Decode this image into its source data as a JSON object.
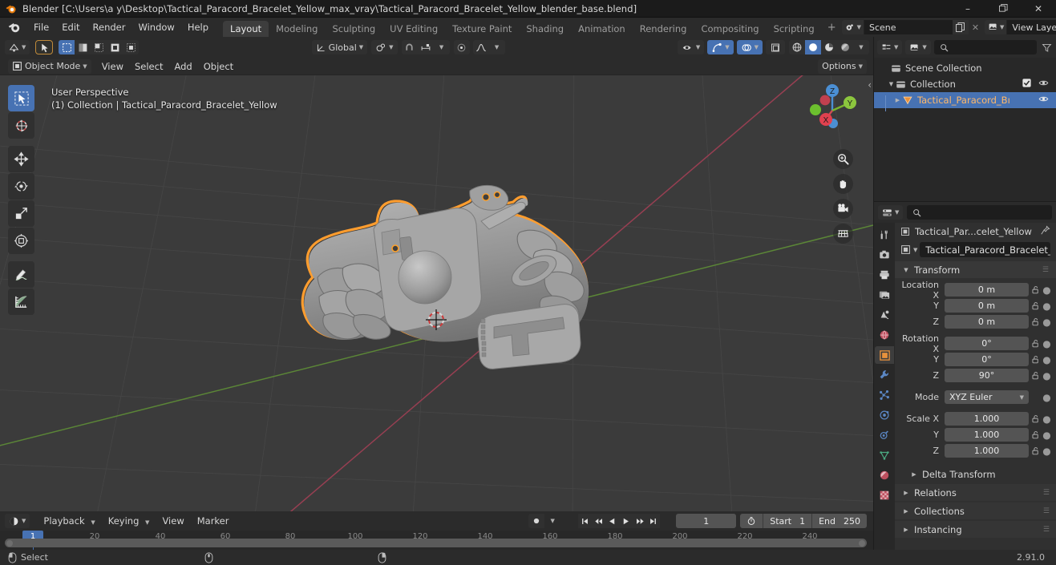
{
  "window": {
    "title": "Blender [C:\\Users\\a y\\Desktop\\Tactical_Paracord_Bracelet_Yellow_max_vray\\Tactical_Paracord_Bracelet_Yellow_blender_base.blend]",
    "minimize": "–",
    "maximize": "❐",
    "close": "✕"
  },
  "menubar": {
    "items": [
      "File",
      "Edit",
      "Render",
      "Window",
      "Help"
    ]
  },
  "workspace_tabs": {
    "items": [
      "Layout",
      "Modeling",
      "Sculpting",
      "UV Editing",
      "Texture Paint",
      "Shading",
      "Animation",
      "Rendering",
      "Compositing",
      "Scripting"
    ],
    "active": "Layout",
    "add_label": "+"
  },
  "topbar_right": {
    "scene_name": "Scene",
    "view_layer_name": "View Layer",
    "scene_icon": "scene-icon",
    "view_layer_icon": "view-layer-icon",
    "copy_icon": "new-copy-icon",
    "close_icon": "✕"
  },
  "viewport": {
    "mode_label": "Object Mode",
    "menus": [
      "View",
      "Select",
      "Add",
      "Object"
    ],
    "transform_orientation": "Global",
    "options_label": "Options",
    "overlay_line1": "User Perspective",
    "overlay_line2": "(1) Collection | Tactical_Paracord_Bracelet_Yellow",
    "gizmo_axes": [
      "X",
      "Y",
      "Z"
    ],
    "tools": [
      "tweak-select-tool",
      "cursor-tool",
      "move-tool",
      "rotate-tool",
      "scale-tool",
      "transform-tool",
      "annotate-tool",
      "measure-tool"
    ],
    "nav_buttons": [
      "zoom-icon",
      "pan-hand-icon",
      "camera-view-icon",
      "toggle-ortho-icon"
    ],
    "header_icons": [
      "editor-type-icon",
      "select-mode-icon",
      "box-select-icon",
      "circle-select-icon",
      "lasso-select-icon",
      "snap-magnet-icon",
      "proportional-edit-icon",
      "visibility-icon",
      "gizmo-icon",
      "overlays-icon",
      "xray-icon",
      "shading-wireframe",
      "shading-solid",
      "shading-material",
      "shading-rendered"
    ]
  },
  "outliner": {
    "filter_icon": "filter-icon",
    "display_mode_icon": "display-mode-icon",
    "search_placeholder": "",
    "rows": [
      {
        "label": "Scene Collection",
        "icon": "collection-icon",
        "indent": 10,
        "expand": "",
        "selected": false,
        "checkbox": false,
        "eye": false
      },
      {
        "label": "Collection",
        "icon": "collection-icon",
        "indent": 16,
        "expand": "▼",
        "selected": false,
        "checkbox": true,
        "eye": true
      },
      {
        "label": "Tactical_Paracord_Bı",
        "icon": "mesh-object-icon",
        "indent": 31,
        "expand": "▶",
        "selected": true,
        "checkbox": false,
        "eye": true
      }
    ]
  },
  "properties": {
    "editor_icon": "properties-editor-icon",
    "search_placeholder": "",
    "tabs": [
      "tool-tab",
      "render-tab",
      "output-tab",
      "view-layer-tab",
      "scene-tab",
      "world-tab",
      "object-tab",
      "modifier-tab",
      "particles-tab",
      "physics-tab",
      "constraints-tab",
      "object-data-tab",
      "material-tab",
      "texture-tab"
    ],
    "active_tab": "object-tab",
    "breadcrumb": "Tactical_Par...celet_Yellow",
    "pin_icon": "pin-icon",
    "object_name": "Tactical_Paracord_Bracelet_...",
    "transform_panel": {
      "title": "Transform",
      "rows": [
        {
          "label": "Location X",
          "value": "0 m",
          "lock": true,
          "anim": true
        },
        {
          "label": "Y",
          "value": "0 m",
          "lock": true,
          "anim": true
        },
        {
          "label": "Z",
          "value": "0 m",
          "lock": true,
          "anim": true
        }
      ],
      "rotation_rows": [
        {
          "label": "Rotation X",
          "value": "0°",
          "lock": true,
          "anim": true
        },
        {
          "label": "Y",
          "value": "0°",
          "lock": true,
          "anim": true
        },
        {
          "label": "Z",
          "value": "90°",
          "lock": true,
          "anim": true
        }
      ],
      "mode_label": "Mode",
      "mode_value": "XYZ Euler",
      "scale_rows": [
        {
          "label": "Scale X",
          "value": "1.000",
          "lock": true,
          "anim": true
        },
        {
          "label": "Y",
          "value": "1.000",
          "lock": true,
          "anim": true
        },
        {
          "label": "Z",
          "value": "1.000",
          "lock": true,
          "anim": true
        }
      ]
    },
    "closed_panels": [
      "Delta Transform",
      "Relations",
      "Collections",
      "Instancing"
    ]
  },
  "timeline": {
    "editor_icon": "timeline-editor-icon",
    "menus": [
      "Playback",
      "Keying",
      "View",
      "Marker"
    ],
    "record_icon": "auto-keying-icon",
    "transport": [
      "jump-start-icon",
      "prev-keyframe-icon",
      "play-reverse-icon",
      "play-icon",
      "next-keyframe-icon",
      "jump-end-icon"
    ],
    "current_frame": "1",
    "timer_icon": "use-preview-range-icon",
    "start_label": "Start",
    "start_value": "1",
    "end_label": "End",
    "end_value": "250",
    "ruler_ticks": [
      "20",
      "40",
      "60",
      "80",
      "100",
      "120",
      "140",
      "160",
      "180",
      "200",
      "220",
      "240"
    ],
    "playhead_frame": "1"
  },
  "statusbar": {
    "mouse_left_icon": "mouse-left-icon",
    "select_label": "Select",
    "mouse_mid_icon": "mouse-middle-icon",
    "mouse_right_icon": "mouse-right-icon",
    "version": "2.91.0"
  },
  "colors": {
    "accent_blue": "#4772b3",
    "select_orange": "#ffa028",
    "header_bg": "#2b2b2b",
    "viewport_bg": "#3b3b3b",
    "axis_x": "#a3455c",
    "axis_y": "#6b9b3d"
  }
}
